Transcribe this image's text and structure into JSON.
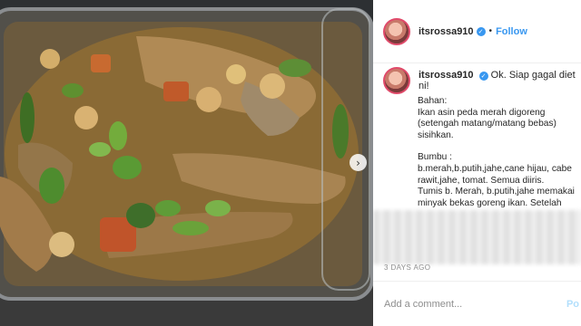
{
  "photo": {
    "alt_icon": "food-photo",
    "next_icon": "chevron-right-icon",
    "next_glyph": "›"
  },
  "post": {
    "username": "itsrossa910",
    "verified_glyph": "✓",
    "separator": "•",
    "follow_label": "Follow"
  },
  "caption": {
    "username": "itsrossa910",
    "headline": "Ok. Siap gagal diet ni!",
    "lines": [
      "Bahan:",
      "Ikan asin peda merah digoreng (setengah matang/matang bebas) sisihkan.",
      "",
      "Bumbu :",
      "b.merah,b.putih,jahe,cane hijau, cabe rawit,jahe, tomat. Semua diiris.",
      "Tumis b. Merah, b.putih,jahe memakai minyak bekas goreng ikan. Setelah"
    ]
  },
  "timestamp": "3 DAYS AGO",
  "comment": {
    "placeholder": "Add a comment...",
    "post_label": "Po"
  },
  "colors": {
    "accent": "#3897f0",
    "text": "#262626",
    "muted": "#8e8e8e"
  }
}
